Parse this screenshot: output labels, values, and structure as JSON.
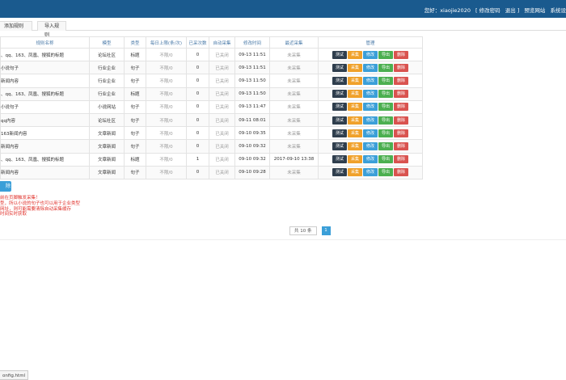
{
  "header": {
    "greeting": "您好：xiaojie2020",
    "change_password": "[ 修改密码",
    "logout": "退出 ]",
    "preview_site": "预览网站",
    "system_settings": "系统设"
  },
  "tabs": [
    {
      "label": "添加规则"
    },
    {
      "label": "导入规则"
    }
  ],
  "table": {
    "columns": [
      "规则名称",
      "模型",
      "类型",
      "每日上限(条/次)",
      "已采次数",
      "自动采集",
      "修改时间",
      "最近采集",
      "管理"
    ],
    "rows": [
      {
        "name": "、qq、163、凤凰、搜狐的标题",
        "model": "论坛社区",
        "type": "标题",
        "limit": "不限/0",
        "count": "0",
        "auto": "已关闭",
        "modified": "09-13 11:51",
        "last": "未采集"
      },
      {
        "name": "小说句子",
        "model": "行业企业",
        "type": "句子",
        "limit": "不限/0",
        "count": "0",
        "auto": "已关闭",
        "modified": "09-13 11:51",
        "last": "未采集"
      },
      {
        "name": "新闻内容",
        "model": "行业企业",
        "type": "句子",
        "limit": "不限/0",
        "count": "0",
        "auto": "已关闭",
        "modified": "09-13 11:50",
        "last": "未采集"
      },
      {
        "name": "、qq、163、凤凰、搜狐的标题",
        "model": "行业企业",
        "type": "标题",
        "limit": "不限/0",
        "count": "0",
        "auto": "已关闭",
        "modified": "09-13 11:50",
        "last": "未采集"
      },
      {
        "name": "小说句子",
        "model": "小说网站",
        "type": "句子",
        "limit": "不限/0",
        "count": "0",
        "auto": "已关闭",
        "modified": "09-13 11:47",
        "last": "未采集"
      },
      {
        "name": "qq内容",
        "model": "论坛社区",
        "type": "句子",
        "limit": "不限/0",
        "count": "0",
        "auto": "已关闭",
        "modified": "09-11 08:01",
        "last": "未采集"
      },
      {
        "name": "163新闻内容",
        "model": "文章新闻",
        "type": "句子",
        "limit": "不限/0",
        "count": "0",
        "auto": "已关闭",
        "modified": "09-10 09:35",
        "last": "未采集"
      },
      {
        "name": "新闻内容",
        "model": "文章新闻",
        "type": "句子",
        "limit": "不限/0",
        "count": "0",
        "auto": "已关闭",
        "modified": "09-10 09:32",
        "last": "未采集"
      },
      {
        "name": "、qq、163、凤凰、搜狐的标题",
        "model": "文章新闻",
        "type": "标题",
        "limit": "不限/0",
        "count": "1",
        "auto": "已关闭",
        "modified": "09-10 09:32",
        "last": "2017-09-10 13:38"
      },
      {
        "name": "新闻内容",
        "model": "文章新闻",
        "type": "句子",
        "limit": "不限/0",
        "count": "0",
        "auto": "已关闭",
        "modified": "09-10 09:28",
        "last": "未采集"
      }
    ],
    "actions": {
      "test": "测试",
      "collect": "采集",
      "edit": "修改",
      "export": "导出",
      "delete": "删除"
    }
  },
  "delete_all": "除",
  "tips": [
    "前在页脚触发采集！",
    "型，所以小说的句子也可以用于企业类型",
    "网址，则可能需要清除自动采集缓存",
    "时间实时获取"
  ],
  "pagination": {
    "total": "共 10 条",
    "current_page": "1"
  },
  "statusbar": "onfig.html",
  "colors": {
    "header_bg": "#1a5a8e",
    "test": "#2f3e4d",
    "collect": "#f0a12a",
    "edit": "#3b9fd8",
    "export": "#4caf50",
    "delete": "#d9534f",
    "tip": "#e0302a"
  }
}
